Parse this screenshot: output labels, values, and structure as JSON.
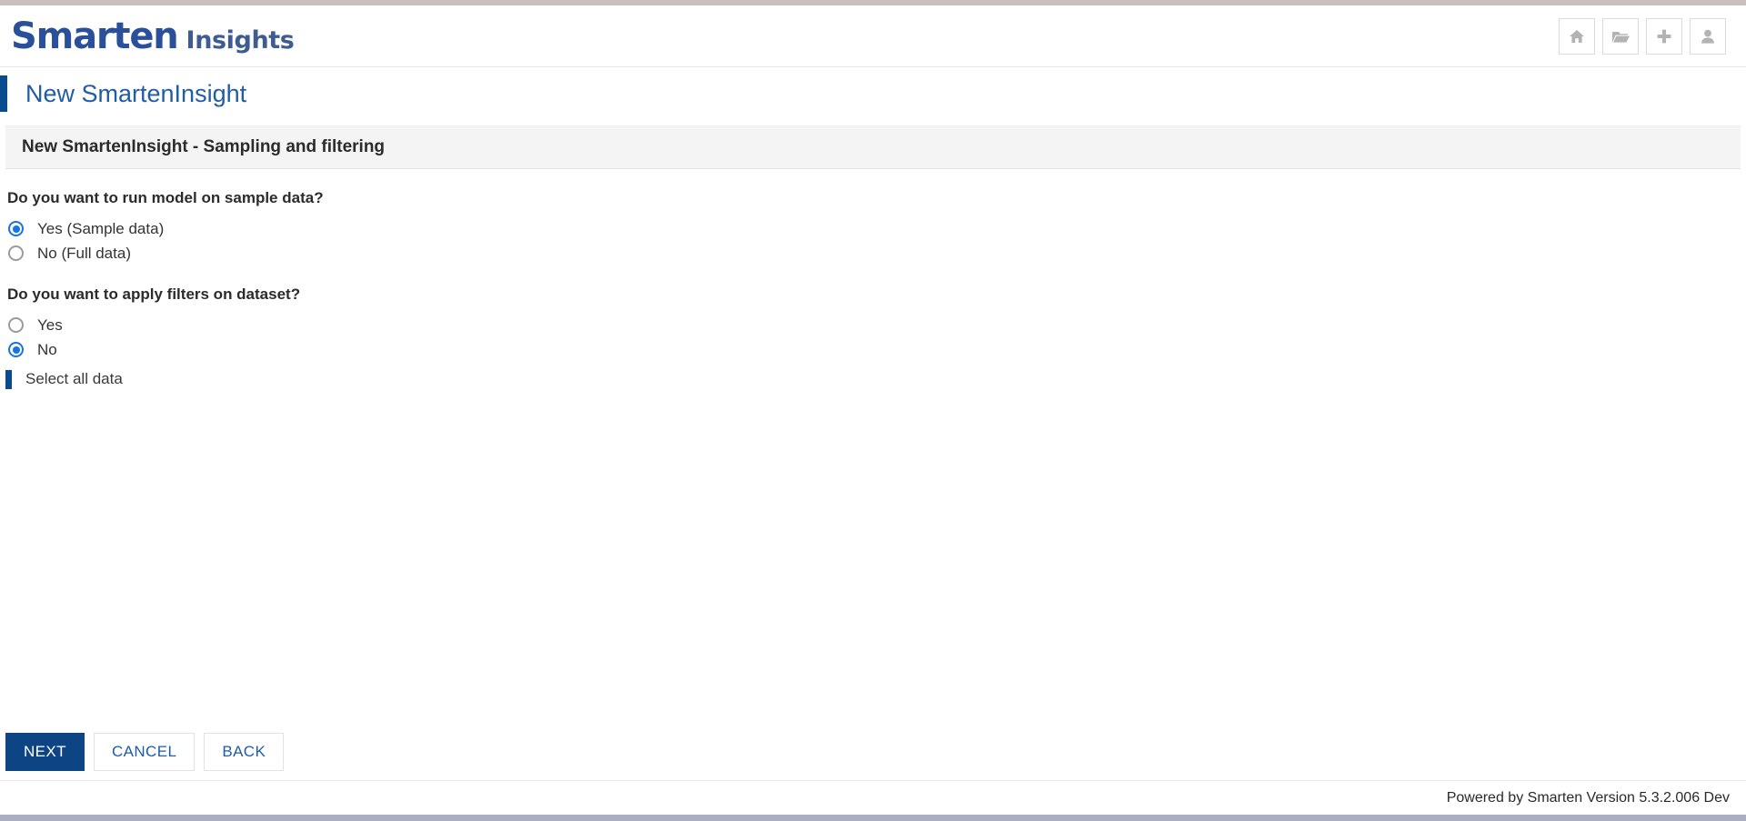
{
  "top_strip_color": "#c9bfbd",
  "bottom_strip_color": "#a9aec1",
  "accent_color": "#0a4a8f",
  "primary_button_color": "#0d4483",
  "link_color": "#215ca6",
  "radio_selected_color": "#1675e0",
  "header": {
    "brand_main": "Smarten",
    "brand_sub": "Insights",
    "actions": [
      {
        "name": "home-icon",
        "label": "Home"
      },
      {
        "name": "folder-open-icon",
        "label": "Open"
      },
      {
        "name": "plus-icon",
        "label": "New"
      },
      {
        "name": "user-icon",
        "label": "User"
      }
    ]
  },
  "page": {
    "title": "New SmartenInsight",
    "section_title": "New SmartenInsight - Sampling and filtering"
  },
  "form": {
    "question_sample": "Do you want to run model on sample data?",
    "sample_options": [
      {
        "label": "Yes (Sample data)",
        "checked": true
      },
      {
        "label": "No (Full data)",
        "checked": false
      }
    ],
    "question_filters": "Do you want to apply filters on dataset?",
    "filter_options": [
      {
        "label": "Yes",
        "checked": false
      },
      {
        "label": "No",
        "checked": true
      }
    ],
    "select_all_label": "Select all data"
  },
  "buttons": {
    "next": "NEXT",
    "cancel": "CANCEL",
    "back": "BACK"
  },
  "footer": {
    "powered_by": "Powered by Smarten Version 5.3.2.006 Dev"
  }
}
